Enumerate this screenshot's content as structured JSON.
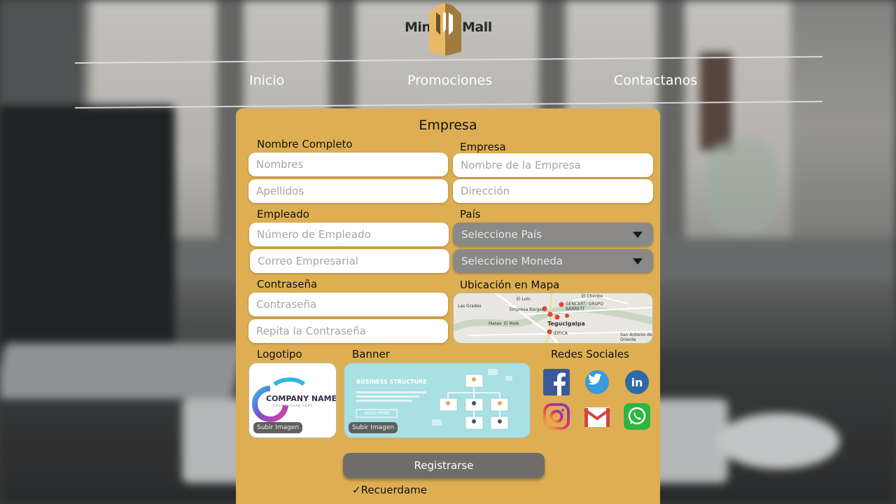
{
  "brand": {
    "left": "Mini",
    "right": "Mall"
  },
  "nav": {
    "items": [
      "Inicio",
      "Promociones",
      "Contactanos"
    ]
  },
  "form": {
    "title": "Empresa",
    "personal": {
      "label": "Nombre Completo",
      "first_placeholder": "Nombres",
      "last_placeholder": "Apellidos"
    },
    "company": {
      "label": "Empresa",
      "name_placeholder": "Nombre de la Empresa",
      "address_placeholder": "Dirección"
    },
    "employee": {
      "label": "Empleado",
      "number_placeholder": "Número de Empleado",
      "email_placeholder": "Correo Empresarial"
    },
    "country": {
      "label": "País",
      "country_select": "Seleccione País",
      "currency_select": "Seleccione Moneda"
    },
    "password": {
      "label": "Contraseña",
      "password_placeholder": "Contraseña",
      "repeat_placeholder": "Repita la Contraseña"
    },
    "map": {
      "label": "Ubicación en Mapa",
      "places": [
        "El Chimbo",
        "El Lolo",
        "Las Grades",
        "Empresa Bargan",
        "GENCART/ GRUPO BARRETT",
        "Mateo",
        "El Molo",
        "Tegucigalpa",
        "IDFICA",
        "San Antonio de Oriente"
      ]
    },
    "logo": {
      "label": "Logotipo",
      "company_name": "COMPANY NAME",
      "tagline": "YOUR SLOGAN HERE",
      "upload": "Subir Imagen"
    },
    "banner": {
      "label": "Banner",
      "heading": "BUSINESS STRUCTURE",
      "cta": "READ MORE",
      "upload": "Subir Imagen"
    },
    "social": {
      "label": "Redes Sociales",
      "icons": [
        "facebook-icon",
        "twitter-icon",
        "linkedin-icon",
        "instagram-icon",
        "gmail-icon",
        "whatsapp-icon"
      ]
    },
    "submit": "Registrarse",
    "remember": "✓Recuerdame"
  },
  "colors": {
    "card": "#deaf52",
    "select": "#8a8987",
    "button": "#6e6d6b",
    "logo_accent": "#e9b968"
  }
}
